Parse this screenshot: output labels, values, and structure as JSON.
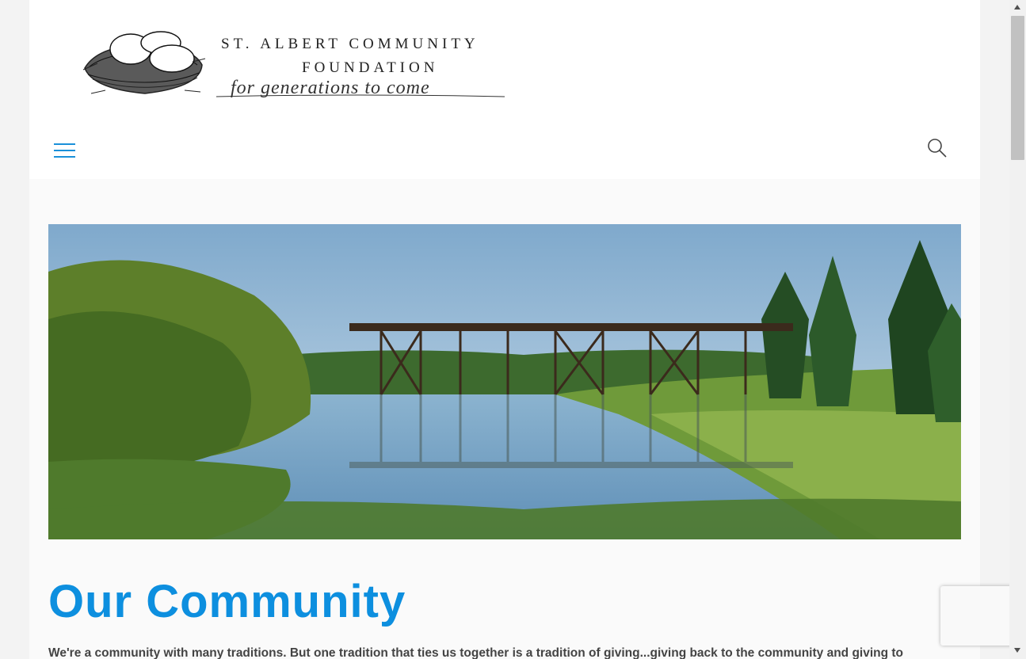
{
  "header": {
    "logo": {
      "line1": "ST. ALBERT COMMUNITY",
      "line2": "FOUNDATION",
      "tagline": "for generations to come"
    },
    "menu_icon": "hamburger-menu-icon",
    "search_icon": "search-icon"
  },
  "hero": {
    "image": "river-trestle-bridge-photo"
  },
  "main": {
    "title": "Our Community",
    "intro": "We're a community with many traditions. But one tradition that ties us together is a tradition of giving...giving back to the community and giving to"
  },
  "colors": {
    "accent": "#0d8fdf",
    "menu_icon": "#1a90d9",
    "body_text": "#444444"
  }
}
